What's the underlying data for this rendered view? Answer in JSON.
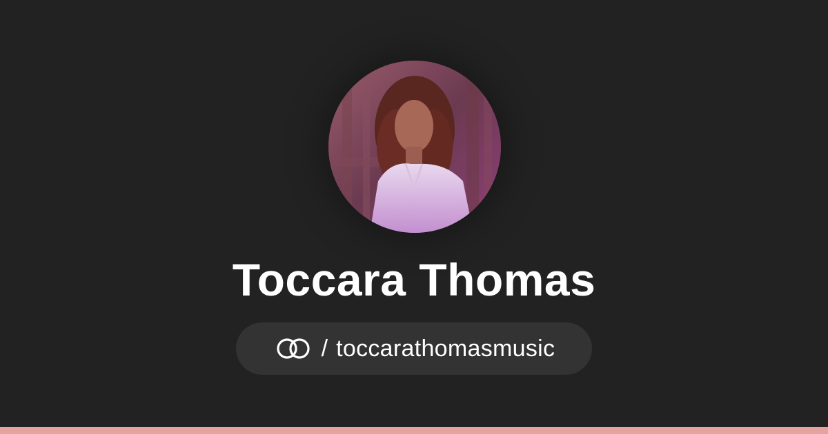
{
  "profile": {
    "name": "Toccara Thomas",
    "separator": "/",
    "handle": "toccarathomasmusic",
    "avatar_icon": "profile-photo"
  },
  "brand": {
    "icon": "linked-rings-icon"
  },
  "colors": {
    "background": "#222222",
    "pill": "#333333",
    "text": "#ffffff",
    "accent_bar": "#e4a39e"
  }
}
